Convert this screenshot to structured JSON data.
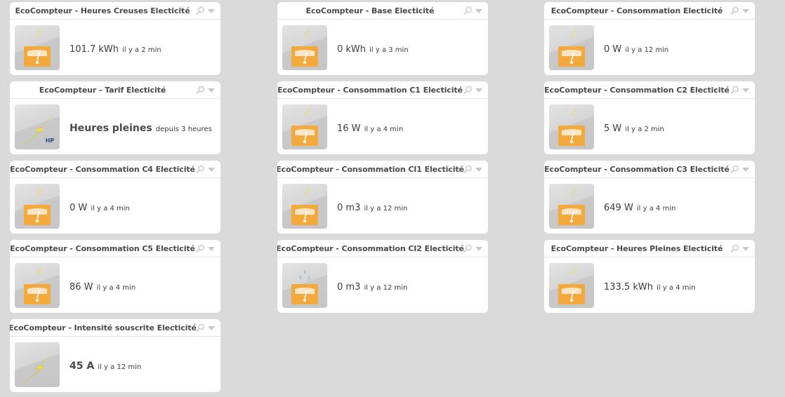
{
  "widgets": [
    {
      "title": "EcoCompteur - Heures Creuses Electicité",
      "value": "101.7 kWh",
      "since": "il y a 2 min",
      "icon": "electric-meter-icon"
    },
    {
      "title": "EcoCompteur - Base Electicité",
      "value": "0 kWh",
      "since": "il y a 3 min",
      "icon": "electric-meter-icon"
    },
    {
      "title": "EcoCompteur - Consommation Electicité",
      "value": "0 W",
      "since": "il y a 12 min",
      "icon": "electric-meter-icon"
    },
    {
      "title": "EcoCompteur - Tarif Electicité",
      "value": "Heures pleines",
      "since": "depuis 3 heures",
      "icon": "lightning-hp-icon",
      "badge": "HP"
    },
    {
      "title": "EcoCompteur - Consommation C1 Electicité",
      "value": "16 W",
      "since": "il y a 4 min",
      "icon": "electric-meter-icon"
    },
    {
      "title": "EcoCompteur - Consommation C2 Electicité",
      "value": "5 W",
      "since": "il y a 2 min",
      "icon": "electric-meter-icon"
    },
    {
      "title": "EcoCompteur - Consommation C4 Electicité",
      "value": "0 W",
      "since": "il y a 4 min",
      "icon": "electric-meter-icon"
    },
    {
      "title": "EcoCompteur - Consommation CI1 Electicité",
      "value": "0 m3",
      "since": "il y a 12 min",
      "icon": "electric-meter-icon"
    },
    {
      "title": "EcoCompteur - Consommation C3 Electicité",
      "value": "649 W",
      "since": "il y a 4 min",
      "icon": "electric-meter-icon"
    },
    {
      "title": "EcoCompteur - Consommation C5 Electicité",
      "value": "86 W",
      "since": "il y a 4 min",
      "icon": "electric-meter-icon"
    },
    {
      "title": "EcoCompteur - Consommation CI2 Electicité",
      "value": "0 m3",
      "since": "il y a 12 min",
      "icon": "water-meter-icon"
    },
    {
      "title": "EcoCompteur - Heures Pleines Electicité",
      "value": "133.5 kWh",
      "since": "il y a 4 min",
      "icon": "electric-meter-icon"
    },
    {
      "title": "EcoCompteur - Intensité souscrite Electicité",
      "value": "45 A",
      "since": "il y a 12 min",
      "icon": "lightning-icon"
    }
  ],
  "colors": {
    "background": "#dadada",
    "meter_orange": "#f3a93c",
    "lightning_yellow": "#f0e040",
    "water_blue": "#9cc8e8",
    "badge_blue": "#2a4f8a"
  }
}
